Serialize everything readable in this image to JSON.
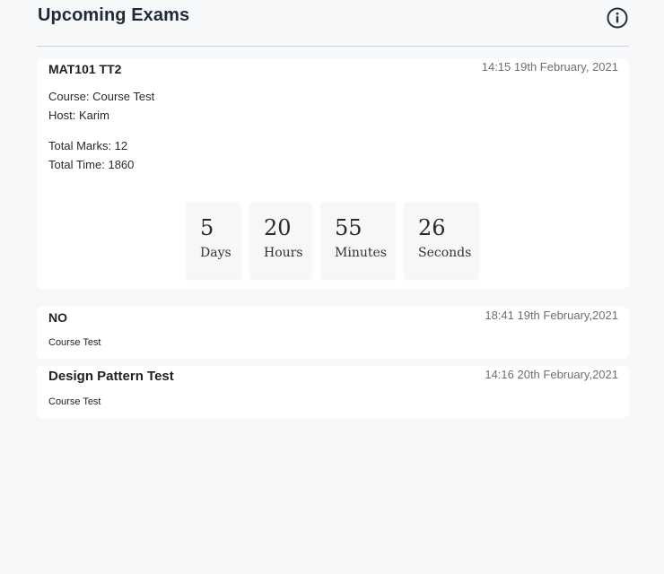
{
  "header": {
    "title": "Upcoming Exams",
    "info_icon": "info-circle-icon"
  },
  "exams": [
    {
      "title": "MAT101 TT2",
      "datetime": "14:15 19th February, 2021",
      "course": "Course: Course Test",
      "host": "Host: Karim",
      "total_marks": "Total Marks: 12",
      "total_time": "Total Time: 1860",
      "countdown": {
        "days": {
          "value": "5",
          "label": "Days"
        },
        "hours": {
          "value": "20",
          "label": "Hours"
        },
        "minutes": {
          "value": "55",
          "label": "Minutes"
        },
        "seconds": {
          "value": "26",
          "label": "Seconds"
        }
      }
    },
    {
      "title": "NO",
      "datetime": "18:41 19th February,2021",
      "course": "Course Test"
    },
    {
      "title": "Design Pattern Test",
      "datetime": "14:16 20th February,2021",
      "course": "Course Test"
    }
  ]
}
